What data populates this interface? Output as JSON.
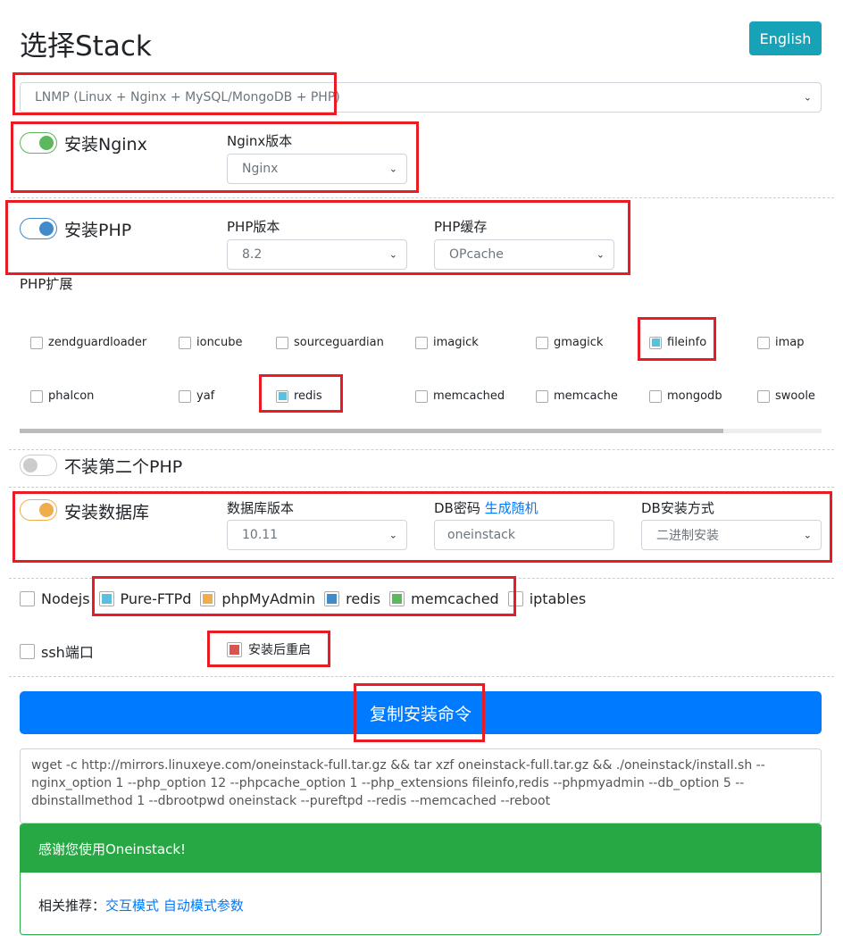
{
  "title": "选择Stack",
  "lang_button": "English",
  "stack_select": "LNMP (Linux + Nginx + MySQL/MongoDB + PHP)",
  "nginx": {
    "toggle_label": "安装Nginx",
    "version_label": "Nginx版本",
    "version_value": "Nginx",
    "on": true,
    "color": "#5cb85c"
  },
  "php": {
    "toggle_label": "安装PHP",
    "version_label": "PHP版本",
    "version_value": "8.2",
    "cache_label": "PHP缓存",
    "cache_value": "OPcache",
    "on": true,
    "color": "#428bca",
    "ext_label": "PHP扩展",
    "extensions": [
      {
        "name": "zendguardloader",
        "checked": false
      },
      {
        "name": "ioncube",
        "checked": false
      },
      {
        "name": "sourceguardian",
        "checked": false
      },
      {
        "name": "imagick",
        "checked": false
      },
      {
        "name": "gmagick",
        "checked": false
      },
      {
        "name": "fileinfo",
        "checked": true
      },
      {
        "name": "imap",
        "checked": false
      },
      {
        "name": "phalcon",
        "checked": false
      },
      {
        "name": "yaf",
        "checked": false
      },
      {
        "name": "redis",
        "checked": true
      },
      {
        "name": "memcached",
        "checked": false
      },
      {
        "name": "memcache",
        "checked": false
      },
      {
        "name": "mongodb",
        "checked": false
      },
      {
        "name": "swoole",
        "checked": false
      }
    ],
    "ext_check_color": "#5bc0de"
  },
  "php2": {
    "toggle_label": "不装第二个PHP",
    "on": false
  },
  "db": {
    "toggle_label": "安装数据库",
    "version_label": "数据库版本",
    "version_value": "10.11",
    "pwd_label": "DB密码",
    "pwd_link": "生成随机",
    "pwd_value": "oneinstack",
    "method_label": "DB安装方式",
    "method_value": "二进制安装",
    "on": true,
    "color": "#f0ad4e"
  },
  "options": [
    {
      "name": "Nodejs",
      "checked": false,
      "color": ""
    },
    {
      "name": "Pure-FTPd",
      "checked": true,
      "color": "#5bc0de"
    },
    {
      "name": "phpMyAdmin",
      "checked": true,
      "color": "#f0ad4e"
    },
    {
      "name": "redis",
      "checked": true,
      "color": "#428bca"
    },
    {
      "name": "memcached",
      "checked": true,
      "color": "#5cb85c"
    },
    {
      "name": "iptables",
      "checked": false,
      "color": ""
    }
  ],
  "ssh_label": "ssh端口",
  "reboot_label": "安装后重启",
  "reboot_color": "#d9534f",
  "copy_button": "复制安装命令",
  "command": "wget -c http://mirrors.linuxeye.com/oneinstack-full.tar.gz && tar xzf oneinstack-full.tar.gz && ./oneinstack/install.sh --nginx_option 1 --php_option 12 --phpcache_option 1 --php_extensions fileinfo,redis --phpmyadmin  --db_option 5 --dbinstallmethod 1 --dbrootpwd oneinstack --pureftpd  --redis  --memcached  --reboot",
  "card": {
    "header": "感谢您使用Oneinstack!",
    "rec_label": "相关推荐：",
    "links": [
      "交互模式",
      "自动模式参数"
    ]
  }
}
